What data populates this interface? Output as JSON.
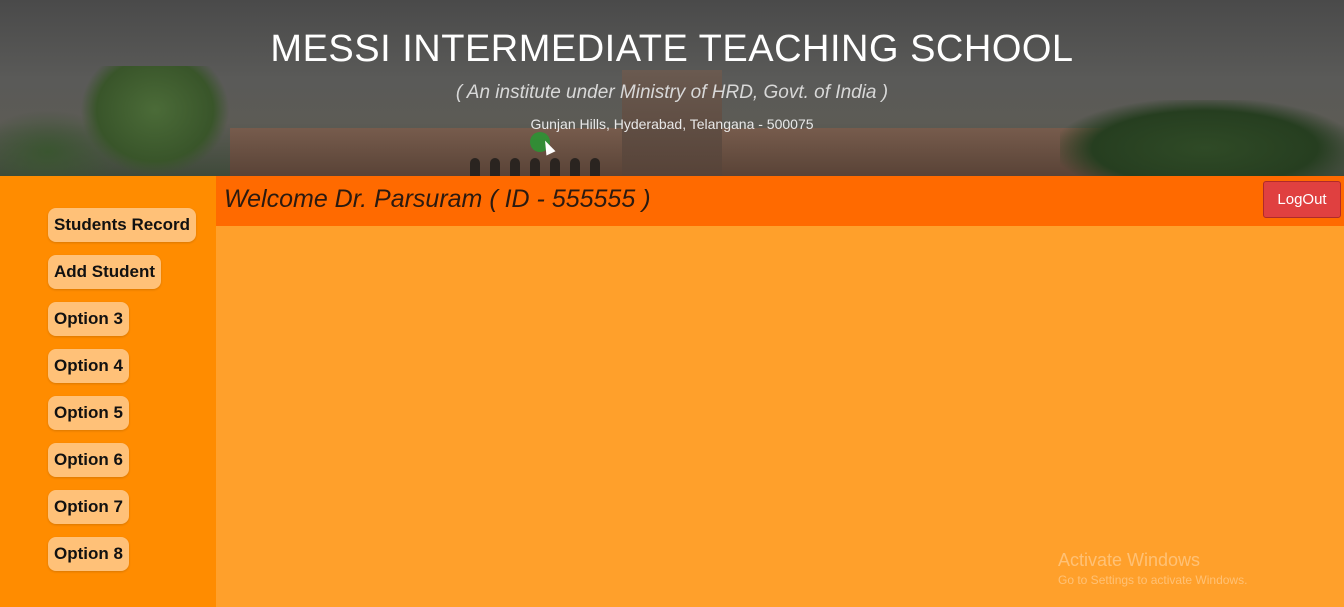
{
  "header": {
    "title": "MESSI INTERMEDIATE TEACHING SCHOOL",
    "subtitle": "( An institute under Ministry of HRD, Govt. of India )",
    "address": "Gunjan Hills, Hyderabad, Telangana - 500075"
  },
  "sidebar": {
    "items": [
      {
        "label": "Students Record"
      },
      {
        "label": "Add Student"
      },
      {
        "label": "Option 3"
      },
      {
        "label": "Option 4"
      },
      {
        "label": "Option 5"
      },
      {
        "label": "Option 6"
      },
      {
        "label": "Option 7"
      },
      {
        "label": "Option 8"
      }
    ]
  },
  "welcome": {
    "text": "Welcome Dr. Parsuram ( ID - 555555 )",
    "logout_label": "LogOut"
  },
  "watermark": {
    "line1": "Activate Windows",
    "line2": "Go to Settings to activate Windows."
  },
  "colors": {
    "sidebar_bg": "#ff8c00",
    "welcome_bar_bg": "#ff6a00",
    "content_bg": "#ffa02b",
    "nav_button_bg": "#ffc178",
    "logout_bg": "#e04040"
  }
}
